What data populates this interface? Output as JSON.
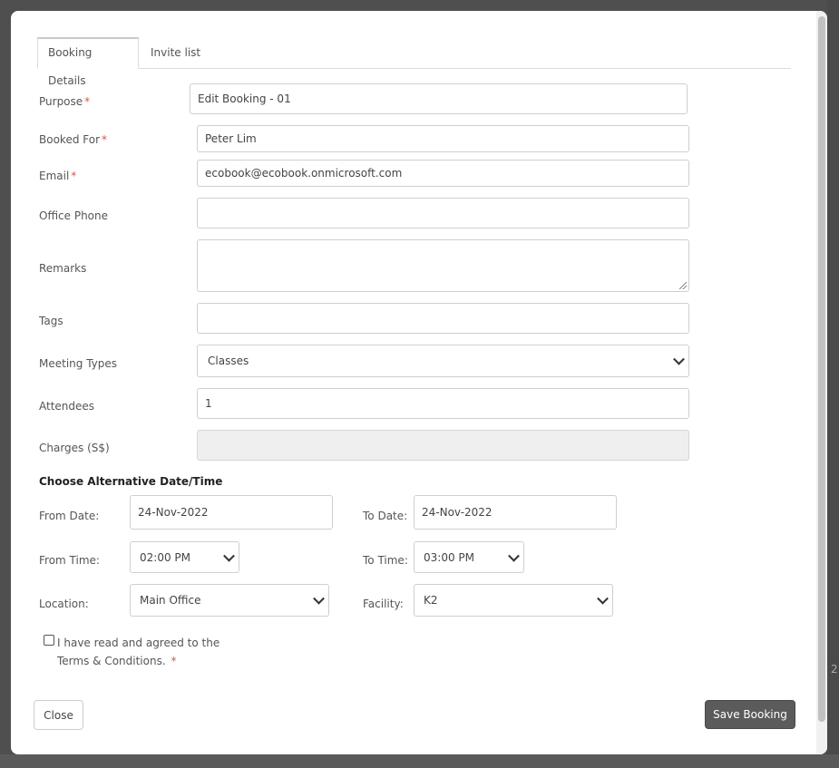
{
  "tabs": [
    "Booking Details",
    "Invite list"
  ],
  "form": {
    "purpose": {
      "label": "Purpose",
      "required_mark": "*",
      "value": "Edit Booking - 01"
    },
    "booked_for": {
      "label": "Booked For",
      "required_mark": "*",
      "value": "Peter Lim"
    },
    "email": {
      "label": "Email",
      "required_mark": "*",
      "value": "ecobook@ecobook.onmicrosoft.com"
    },
    "office_phone": {
      "label": "Office Phone",
      "value": ""
    },
    "remarks": {
      "label": "Remarks",
      "value": ""
    },
    "tags": {
      "label": "Tags",
      "value": ""
    },
    "meeting_types": {
      "label": "Meeting Types",
      "value": "Classes"
    },
    "attendees": {
      "label": "Attendees",
      "value": "1"
    },
    "charges": {
      "label": "Charges (S$)",
      "value": ""
    }
  },
  "alt": {
    "title": "Choose Alternative Date/Time",
    "from_date": {
      "label": "From Date:",
      "value": "24-Nov-2022"
    },
    "to_date": {
      "label": "To Date:",
      "value": "24-Nov-2022"
    },
    "from_time": {
      "label": "From Time:",
      "value": "02:00 PM"
    },
    "to_time": {
      "label": "To Time:",
      "value": "03:00 PM"
    },
    "location": {
      "label": "Location:",
      "value": "Main Office"
    },
    "facility": {
      "label": "Facility:",
      "value": "K2"
    }
  },
  "terms": {
    "line1": "I have read and agreed to the",
    "line2": "Terms & Conditions.",
    "required_mark": "*",
    "checked": false
  },
  "buttons": {
    "close": "Close",
    "save": "Save Booking"
  },
  "background": {
    "edge_text": "2"
  }
}
